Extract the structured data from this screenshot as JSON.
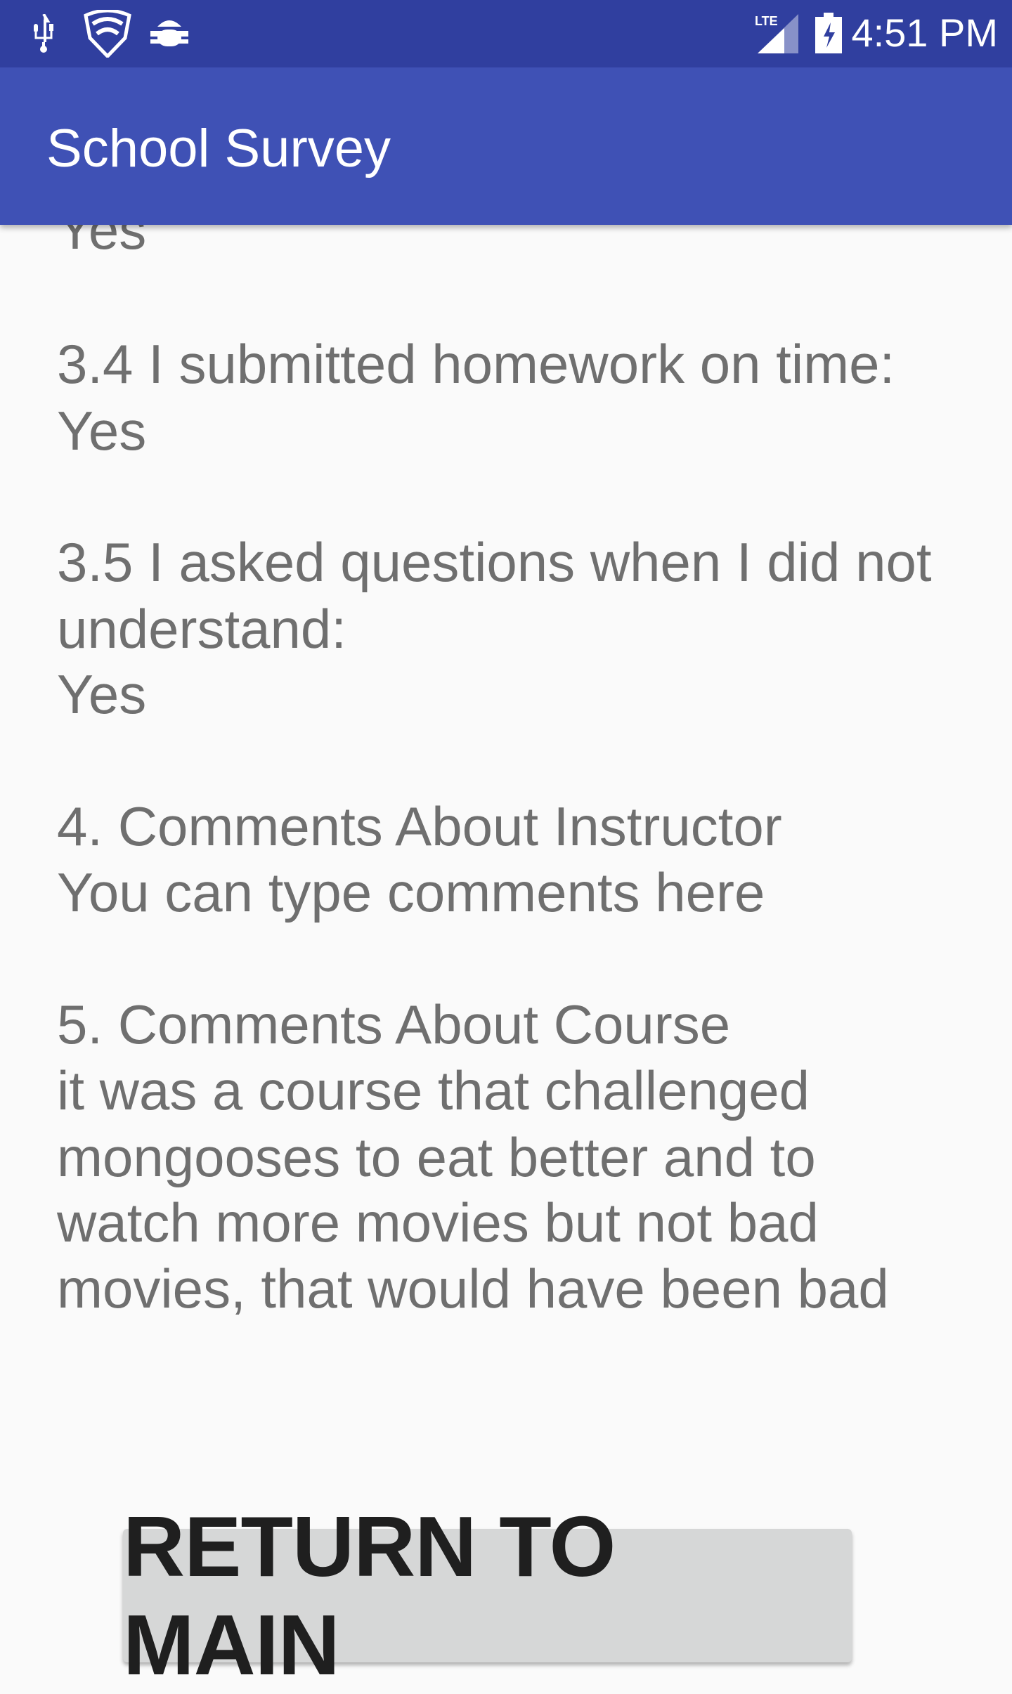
{
  "status_bar": {
    "time": "4:51 PM",
    "network": "LTE",
    "icons": [
      "usb-icon",
      "shield-wifi-icon",
      "android-debug-icon",
      "signal-icon",
      "battery-charging-icon"
    ]
  },
  "app_bar": {
    "title": "School Survey"
  },
  "content": {
    "prev_answer": "Yes",
    "q3_4": {
      "question": "3.4 I submitted homework on time:",
      "answer": "Yes"
    },
    "q3_5": {
      "question_line1": "3.5 I asked questions when I did not",
      "question_line2": "understand:",
      "answer": "Yes"
    },
    "q4": {
      "heading": "4. Comments About Instructor",
      "answer": "You can type comments here"
    },
    "q5": {
      "heading": "5. Comments About Course",
      "answer_lines": [
        "it was a course that challenged",
        "mongooses to eat better and to",
        "watch more movies but not bad",
        "movies, that would have been bad"
      ]
    }
  },
  "button": {
    "label": "RETURN TO MAIN"
  },
  "colors": {
    "status_bar": "#303f9f",
    "app_bar": "#3f51b5",
    "background": "#fafafa",
    "button": "#d6d7d7"
  }
}
